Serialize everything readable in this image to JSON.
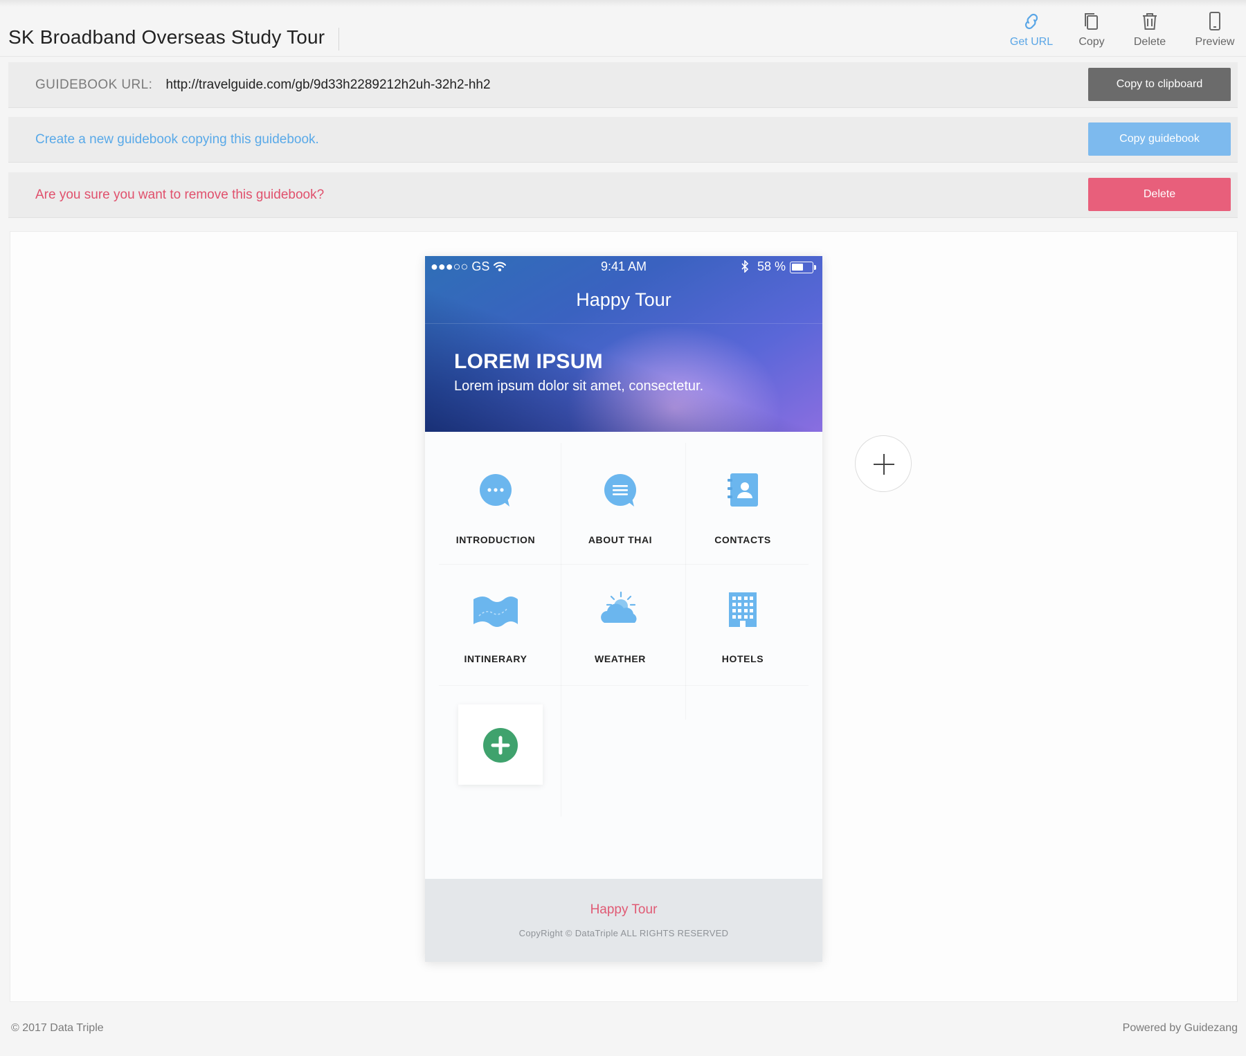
{
  "header": {
    "title": "SK Broadband Overseas Study Tour",
    "tools": [
      {
        "label": "Get URL",
        "icon": "link-icon",
        "active": true
      },
      {
        "label": "Copy",
        "icon": "copy-icon"
      },
      {
        "label": "Delete",
        "icon": "trash-icon"
      },
      {
        "label": "Preview",
        "icon": "phone-icon"
      }
    ],
    "accent_color": "#5aa6e6"
  },
  "url_bar": {
    "label": "GUIDEBOOK URL:",
    "value": "http://travelguide.com/gb/9d33h2289212h2uh-32h2-hh2",
    "button": "Copy to clipboard"
  },
  "copy_bar": {
    "text": "Create a new guidebook copying this guidebook.",
    "button": "Copy guidebook",
    "color": "#7dbaee"
  },
  "delete_bar": {
    "text": "Are you sure you want to remove this guidebook?",
    "button": "Delete",
    "color": "#e85f7b"
  },
  "phone": {
    "status": {
      "carrier": "●●●○○ GS",
      "time": "9:41 AM",
      "battery": "58 %",
      "battery_level": 0.58
    },
    "app_title": "Happy Tour",
    "hero": {
      "heading": "LOREM IPSUM",
      "subtitle": "Lorem ipsum dolor sit amet, consectetur."
    },
    "menu": [
      {
        "label": "INTRODUCTION",
        "icon": "chat-bubble-dots-icon"
      },
      {
        "label": "ABOUT THAI",
        "icon": "chat-bubble-lines-icon"
      },
      {
        "label": "CONTACTS",
        "icon": "contact-book-icon"
      },
      {
        "label": "INTINERARY",
        "icon": "map-icon"
      },
      {
        "label": "WEATHER",
        "icon": "weather-sun-cloud-icon"
      },
      {
        "label": "HOTELS",
        "icon": "hotel-building-icon"
      }
    ],
    "footer": {
      "title": "Happy Tour",
      "copyright": "CopyRight © DataTriple ALL RIGHTS RESERVED"
    }
  },
  "footer": {
    "left": "© 2017 Data Triple",
    "right": "Powered by Guidezang"
  }
}
